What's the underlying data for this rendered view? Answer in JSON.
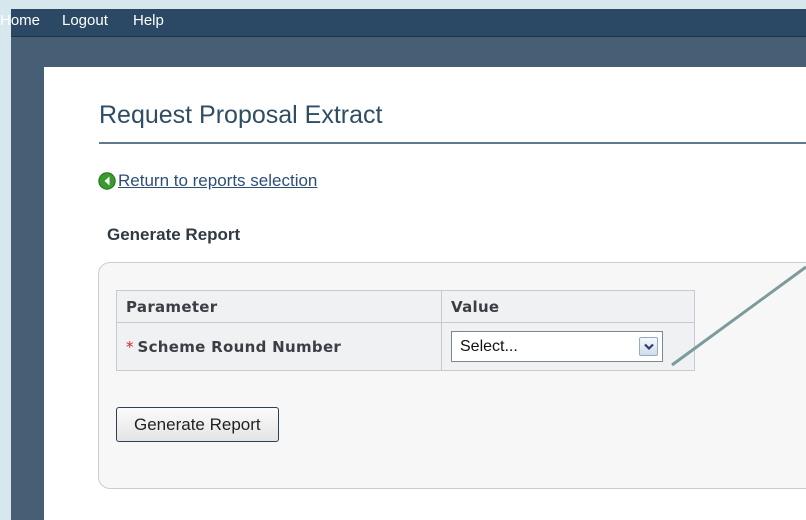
{
  "topnav": {
    "home": "Home",
    "logout": "Logout",
    "help": "Help"
  },
  "page": {
    "title": "Request Proposal Extract",
    "back_link": " Return to reports selection",
    "section_heading": "Generate Report"
  },
  "parameters_table": {
    "headers": [
      "Parameter",
      "Value"
    ],
    "rows": [
      {
        "required_marker": "*",
        "name": "Scheme Round Number",
        "select_value": "Select..."
      }
    ]
  },
  "actions": {
    "generate_label": "Generate Report"
  },
  "colors": {
    "page_background": "#d6e7ee",
    "navbar": "#2b4964",
    "window_frame": "#465f74",
    "title_text": "#2f4d65",
    "link": "#2d4f77",
    "required_marker": "#d8231c",
    "callout_line": "#7c9b9b",
    "back_icon": "#3a9a2c"
  },
  "icons": {
    "back": "green-circle-back-arrow-icon",
    "dropdown": "chevron-down-icon"
  }
}
